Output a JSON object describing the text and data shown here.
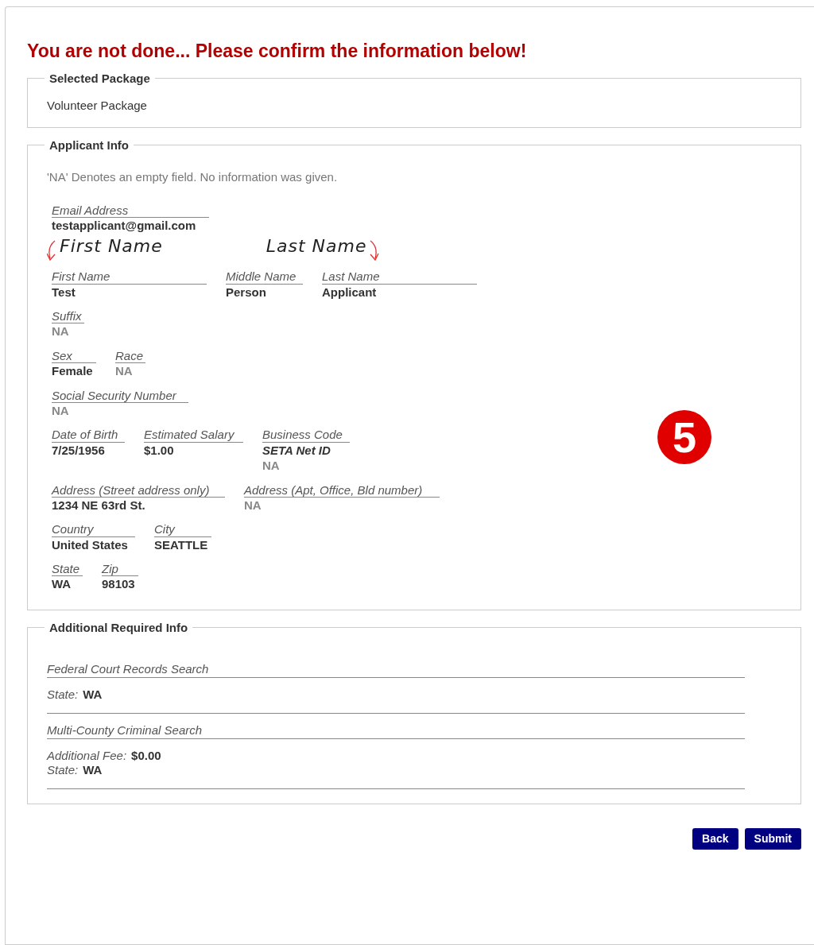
{
  "title": "You are not done... Please confirm the information below!",
  "selected_package": {
    "legend": "Selected Package",
    "value": "Volunteer Package"
  },
  "applicant_info": {
    "legend": "Applicant Info",
    "note": "'NA' Denotes an empty field. No information was given.",
    "annotations": [
      {
        "text": "First Name",
        "kind": "arrow_left"
      },
      {
        "text": "Last Name",
        "kind": "arrow_right"
      }
    ],
    "step_marker": "5",
    "rows": [
      {
        "fields": [
          {
            "label": "Email Address",
            "values": [
              {
                "text": "testapplicant@gmail.com",
                "kind": "filled"
              }
            ]
          }
        ]
      },
      {
        "kind": "annotated",
        "fields": [
          {
            "label": "First Name",
            "values": [
              {
                "text": "Test",
                "kind": "filled"
              }
            ]
          },
          {
            "label": "Middle Name",
            "values": [
              {
                "text": "Person",
                "kind": "filled"
              }
            ]
          },
          {
            "label": "Last Name",
            "values": [
              {
                "text": "Applicant",
                "kind": "filled"
              }
            ]
          }
        ]
      },
      {
        "fields": [
          {
            "label": "Suffix",
            "values": [
              {
                "text": "NA",
                "kind": "empty"
              }
            ]
          }
        ]
      },
      {
        "fields": [
          {
            "label": "Sex",
            "values": [
              {
                "text": "Female",
                "kind": "filled"
              }
            ]
          },
          {
            "label": "Race",
            "values": [
              {
                "text": "NA",
                "kind": "empty"
              }
            ]
          }
        ]
      },
      {
        "fields": [
          {
            "label": "Social Security Number",
            "values": [
              {
                "text": "NA",
                "kind": "empty"
              }
            ]
          }
        ]
      },
      {
        "fields": [
          {
            "label": "Date of Birth",
            "values": [
              {
                "text": "7/25/1956",
                "kind": "filled"
              }
            ]
          },
          {
            "label": "Estimated Salary",
            "values": [
              {
                "text": "$1.00",
                "kind": "filled"
              }
            ]
          },
          {
            "label": "Business Code",
            "values": [
              {
                "text": "SETA Net ID",
                "kind": "emphasis"
              },
              {
                "text": "NA",
                "kind": "empty"
              }
            ]
          }
        ]
      },
      {
        "fields": [
          {
            "label": "Address (Street address only)",
            "values": [
              {
                "text": "1234 NE 63rd St.",
                "kind": "filled"
              }
            ]
          },
          {
            "label": "Address (Apt, Office, Bld number)",
            "values": [
              {
                "text": "NA",
                "kind": "empty"
              }
            ]
          }
        ]
      },
      {
        "fields": [
          {
            "label": "Country",
            "values": [
              {
                "text": "United States",
                "kind": "filled"
              }
            ]
          },
          {
            "label": "City",
            "values": [
              {
                "text": "SEATTLE",
                "kind": "filled"
              }
            ]
          }
        ]
      },
      {
        "fields": [
          {
            "label": "State",
            "values": [
              {
                "text": "WA",
                "kind": "filled"
              }
            ]
          },
          {
            "label": "Zip",
            "values": [
              {
                "text": "98103",
                "kind": "filled"
              }
            ]
          }
        ]
      }
    ]
  },
  "additional_info": {
    "legend": "Additional Required Info",
    "searches": [
      {
        "title": "Federal Court Records Search",
        "details": [
          {
            "label": "State:",
            "value": "WA"
          }
        ]
      },
      {
        "title": "Multi-County Criminal Search",
        "details": [
          {
            "label": "Additional Fee:",
            "value": "$0.00"
          },
          {
            "label": "State:",
            "value": "WA"
          }
        ]
      }
    ]
  },
  "buttons": [
    "Back",
    "Submit"
  ]
}
